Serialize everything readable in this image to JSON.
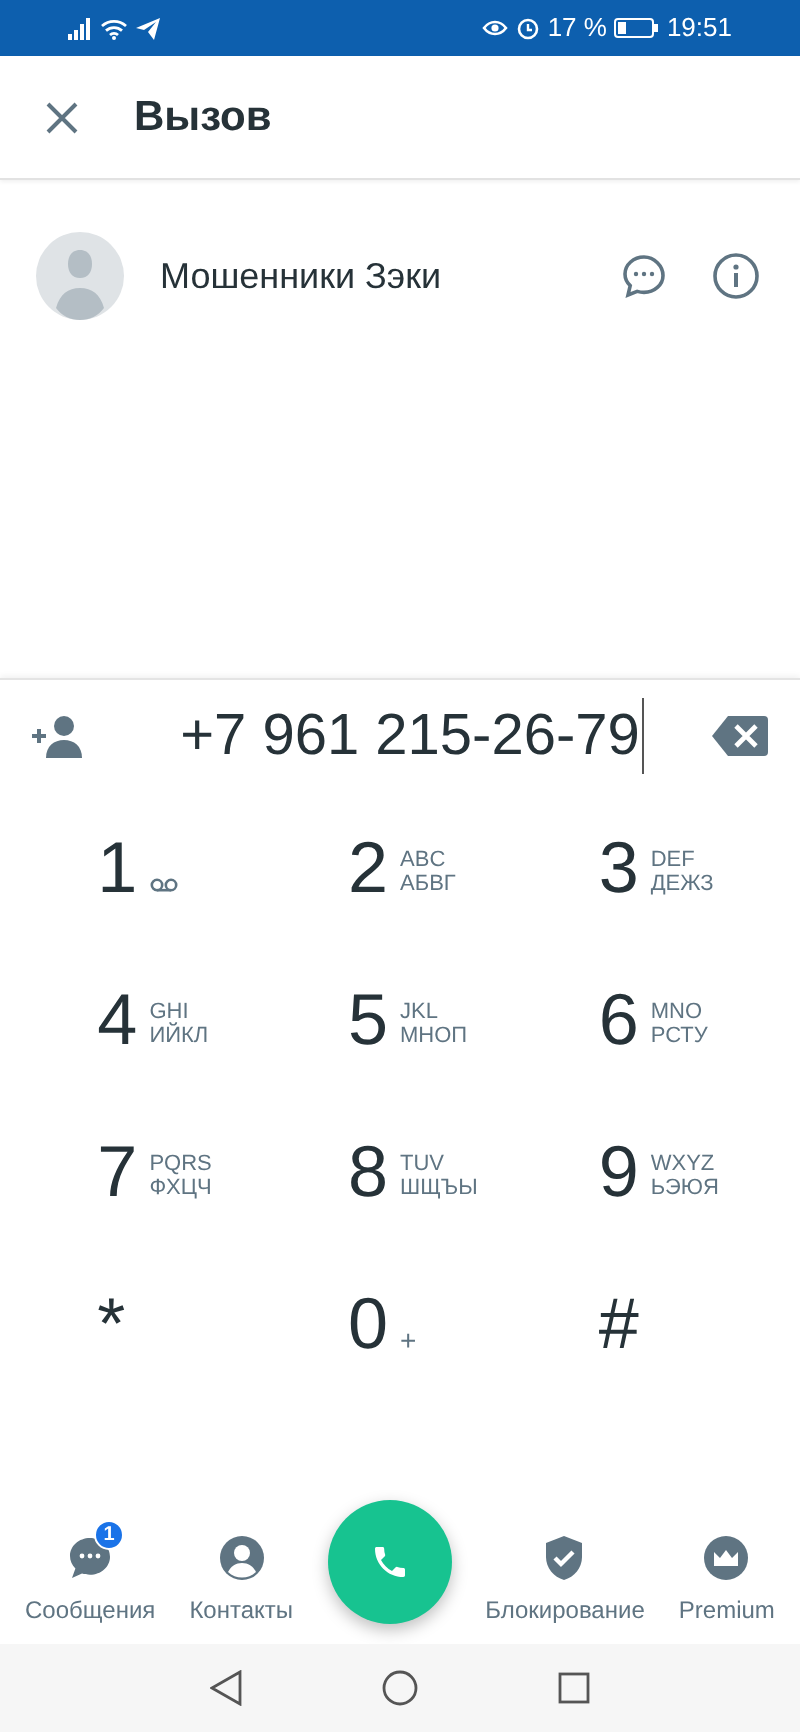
{
  "status_bar": {
    "battery": "17 %",
    "time": "19:51"
  },
  "header": {
    "title": "Вызов"
  },
  "contact": {
    "name": "Мошенники Зэки"
  },
  "dialer": {
    "number": "+7 961 215-26-79"
  },
  "keys": [
    {
      "digit": "1",
      "kind": "voicemail"
    },
    {
      "digit": "2",
      "kind": "letters",
      "latin": "ABC",
      "cyrillic": "АБВГ"
    },
    {
      "digit": "3",
      "kind": "letters",
      "latin": "DEF",
      "cyrillic": "ДЕЖЗ"
    },
    {
      "digit": "4",
      "kind": "letters",
      "latin": "GHI",
      "cyrillic": "ИЙКЛ"
    },
    {
      "digit": "5",
      "kind": "letters",
      "latin": "JKL",
      "cyrillic": "МНОП"
    },
    {
      "digit": "6",
      "kind": "letters",
      "latin": "MNO",
      "cyrillic": "РСТУ"
    },
    {
      "digit": "7",
      "kind": "letters",
      "latin": "PQRS",
      "cyrillic": "ФХЦЧ"
    },
    {
      "digit": "8",
      "kind": "letters",
      "latin": "TUV",
      "cyrillic": "ШЩЪЫ"
    },
    {
      "digit": "9",
      "kind": "letters",
      "latin": "WXYZ",
      "cyrillic": "ЬЭЮЯ"
    },
    {
      "digit": "*",
      "kind": "symbol"
    },
    {
      "digit": "0",
      "kind": "plus",
      "sub": "+"
    },
    {
      "digit": "#",
      "kind": "symbol"
    }
  ],
  "bottom_nav": [
    {
      "label": "Сообщения",
      "kind": "messages",
      "badge": "1"
    },
    {
      "label": "Контакты",
      "kind": "contacts"
    },
    {
      "kind": "call"
    },
    {
      "label": "Блокирование",
      "kind": "block"
    },
    {
      "label": "Premium",
      "kind": "premium"
    }
  ]
}
